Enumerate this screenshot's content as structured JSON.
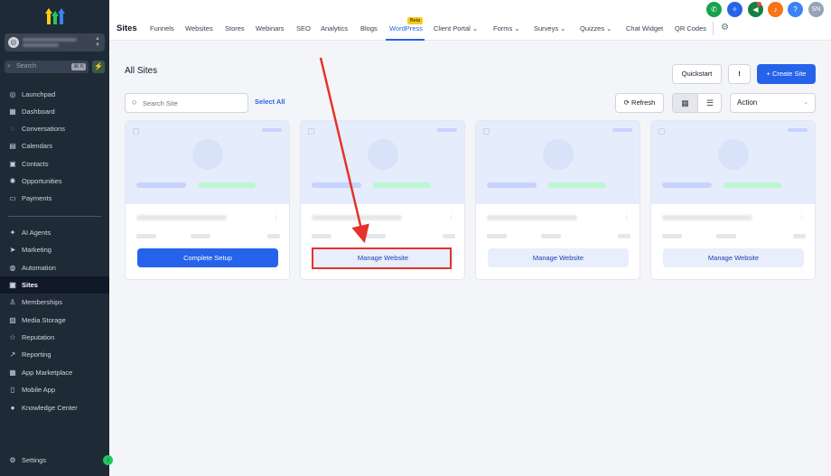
{
  "sidebar": {
    "account_avatar": "◎",
    "search": {
      "placeholder": "Search",
      "shortcut": "⌘ K"
    },
    "bolt_icon": "⚡",
    "items": [
      {
        "label": "Launchpad",
        "icon": "◎"
      },
      {
        "label": "Dashboard",
        "icon": "▦"
      },
      {
        "label": "Conversations",
        "icon": "◌"
      },
      {
        "label": "Calendars",
        "icon": "▤"
      },
      {
        "label": "Contacts",
        "icon": "▣"
      },
      {
        "label": "Opportunities",
        "icon": "✺"
      },
      {
        "label": "Payments",
        "icon": "▭"
      },
      {
        "label": "AI Agents",
        "icon": "✦"
      },
      {
        "label": "Marketing",
        "icon": "➤"
      },
      {
        "label": "Automation",
        "icon": "◍"
      },
      {
        "label": "Sites",
        "icon": "▣"
      },
      {
        "label": "Memberships",
        "icon": "♙"
      },
      {
        "label": "Media Storage",
        "icon": "▨"
      },
      {
        "label": "Reputation",
        "icon": "☆"
      },
      {
        "label": "Reporting",
        "icon": "↗"
      },
      {
        "label": "App Marketplace",
        "icon": "▦"
      },
      {
        "label": "Mobile App",
        "icon": "▯"
      },
      {
        "label": "Knowledge Center",
        "icon": "●"
      }
    ],
    "settings": {
      "label": "Settings",
      "icon": "⚙"
    },
    "collapse_icon": "‹"
  },
  "topnav": {
    "title": "Sites",
    "tabs": [
      {
        "label": "Funnels"
      },
      {
        "label": "Websites"
      },
      {
        "label": "Stores"
      },
      {
        "label": "Webinars"
      },
      {
        "label": "SEO"
      },
      {
        "label": "Analytics"
      },
      {
        "label": "Blogs"
      },
      {
        "label": "WordPress"
      },
      {
        "label": "Client Portal ⌄"
      },
      {
        "label": "Forms ⌄"
      },
      {
        "label": "Surveys ⌄"
      },
      {
        "label": "Quizzes ⌄"
      },
      {
        "label": "Chat Widget"
      },
      {
        "label": "QR Codes"
      }
    ],
    "beta_badge": "Beta",
    "gear_icon": "⚙",
    "icons": {
      "phone": "✆",
      "magic": "✧",
      "megaphone": "◀",
      "bell": "♪",
      "help": "?",
      "user": "SN"
    },
    "colors": {
      "active": "#2563eb",
      "phone": "#16a34a",
      "magic": "#2563eb",
      "megaphone": "#15803d",
      "bell": "#f97316",
      "help": "#3b82f6",
      "user": "#94a3b8"
    }
  },
  "main": {
    "section_title": "All Sites",
    "quickstart": "Quickstart",
    "feedback_icon": "!",
    "create_site": "+ Create Site",
    "search_placeholder": "Search Site",
    "search_icon": "○",
    "select_all": "Select All",
    "refresh": "⟳ Refresh",
    "grid_icon": "▦",
    "list_icon": "☰",
    "action": "Action",
    "action_chevron": "⌄",
    "cards": [
      {
        "button": "Complete Setup",
        "style": "primary"
      },
      {
        "button": "Manage Website",
        "style": "secondary"
      },
      {
        "button": "Manage Website",
        "style": "secondary"
      },
      {
        "button": "Manage Website",
        "style": "secondary"
      }
    ],
    "card_menu_icon": "⋮"
  },
  "annotation": {
    "color": "#e5332a"
  }
}
